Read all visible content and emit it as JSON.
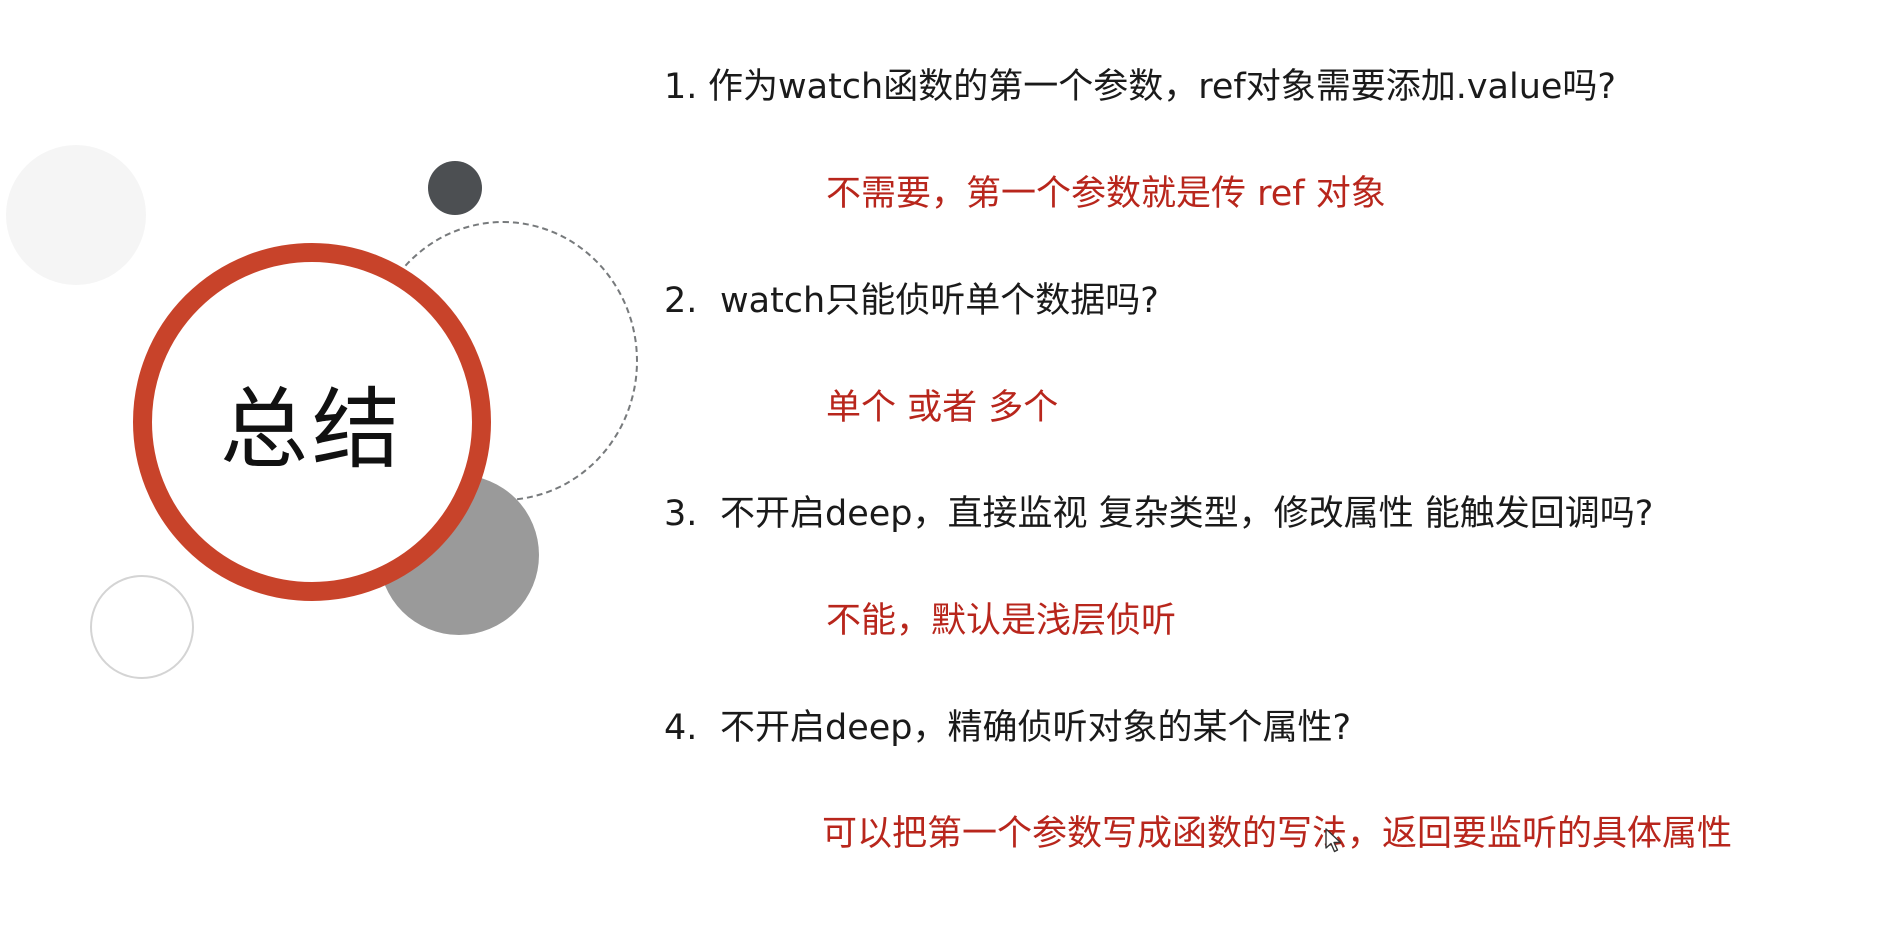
{
  "title": "总结",
  "items": [
    {
      "number": "1.",
      "question": "作为watch函数的第一个参数，ref对象需要添加.value吗?",
      "answer": "不需要，第一个参数就是传 ref 对象"
    },
    {
      "number": "2.",
      "question": "watch只能侦听单个数据吗?",
      "answer": "单个 或者 多个"
    },
    {
      "number": "3.",
      "question": "不开启deep，直接监视 复杂类型，修改属性 能触发回调吗?",
      "answer": "不能，默认是浅层侦听"
    },
    {
      "number": "4.",
      "question": "不开启deep，精确侦听对象的某个属性?",
      "answer": "可以把第一个参数写成函数的写法，返回要监听的具体属性"
    }
  ],
  "colors": {
    "accent_red": "#c8432a",
    "answer_red": "#b8261c",
    "question_text": "#1a1a1a"
  }
}
